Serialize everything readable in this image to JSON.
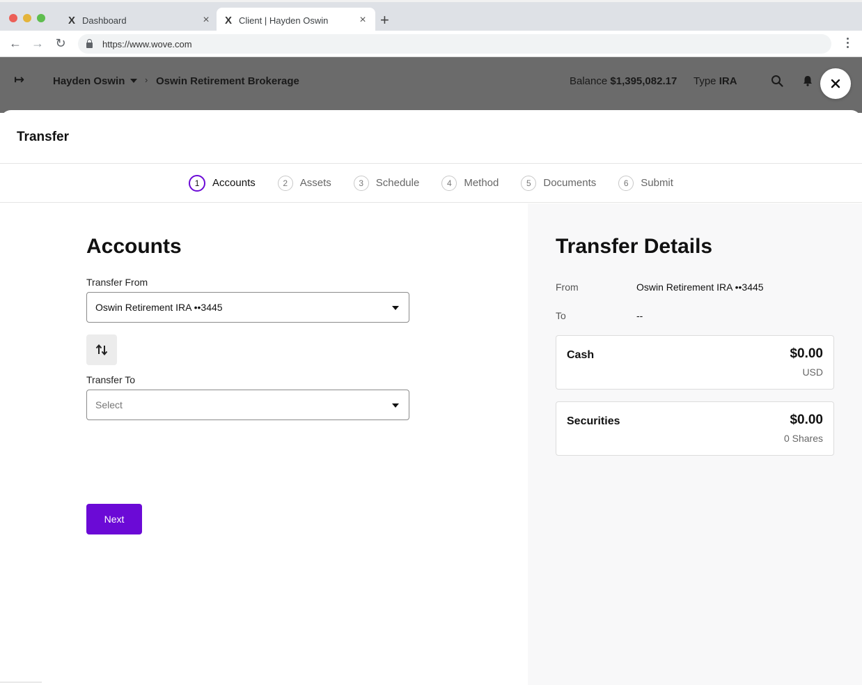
{
  "browser": {
    "tabs": [
      {
        "title": "Dashboard",
        "active": false
      },
      {
        "title": "Client | Hayden Oswin",
        "active": true
      }
    ],
    "url": "https://www.wove.com"
  },
  "header": {
    "client_name": "Hayden Oswin",
    "account_name": "Oswin Retirement Brokerage",
    "balance_label": "Balance",
    "balance_value": "$1,395,082.17",
    "type_label": "Type",
    "type_value": "IRA"
  },
  "modal": {
    "title": "Transfer",
    "steps": [
      {
        "num": "1",
        "label": "Accounts",
        "active": true
      },
      {
        "num": "2",
        "label": "Assets",
        "active": false
      },
      {
        "num": "3",
        "label": "Schedule",
        "active": false
      },
      {
        "num": "4",
        "label": "Method",
        "active": false
      },
      {
        "num": "5",
        "label": "Documents",
        "active": false
      },
      {
        "num": "6",
        "label": "Submit",
        "active": false
      }
    ]
  },
  "accounts": {
    "title": "Accounts",
    "from_label": "Transfer From",
    "from_value": "Oswin Retirement IRA ••3445",
    "to_label": "Transfer To",
    "to_placeholder": "Select",
    "next_label": "Next"
  },
  "details": {
    "title": "Transfer Details",
    "from_key": "From",
    "from_value": "Oswin Retirement IRA ••3445",
    "to_key": "To",
    "to_value": "--",
    "cash": {
      "label": "Cash",
      "amount": "$0.00",
      "sub": "USD"
    },
    "securities": {
      "label": "Securities",
      "amount": "$0.00",
      "sub": "0 Shares"
    }
  },
  "colors": {
    "accent": "#6b0ad6",
    "header_dim": "#6b6b6b",
    "panel_bg": "#f8f8f9"
  }
}
